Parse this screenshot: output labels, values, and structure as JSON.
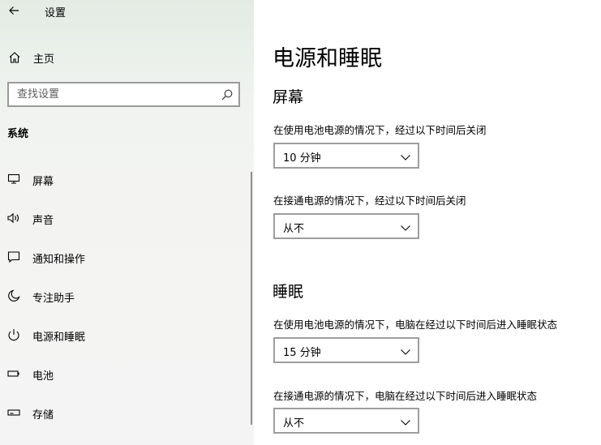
{
  "window": {
    "title": "设置"
  },
  "sidebar": {
    "home_label": "主页",
    "search": {
      "placeholder": "查找设置",
      "value": ""
    },
    "section": "系统",
    "items": [
      {
        "label": "屏幕",
        "icon": "monitor-icon"
      },
      {
        "label": "声音",
        "icon": "speaker-icon"
      },
      {
        "label": "通知和操作",
        "icon": "notification-icon"
      },
      {
        "label": "专注助手",
        "icon": "moon-icon"
      },
      {
        "label": "电源和睡眠",
        "icon": "power-icon"
      },
      {
        "label": "电池",
        "icon": "battery-icon"
      },
      {
        "label": "存储",
        "icon": "storage-icon"
      }
    ]
  },
  "main": {
    "title": "电源和睡眠",
    "screen": {
      "heading": "屏幕",
      "battery_desc": "在使用电池电源的情况下，经过以下时间后关闭",
      "battery_value": "10 分钟",
      "plugged_desc": "在接通电源的情况下，经过以下时间后关闭",
      "plugged_value": "从不"
    },
    "sleep": {
      "heading": "睡眠",
      "battery_desc": "在使用电池电源的情况下，电脑在经过以下时间后进入睡眠状态",
      "battery_value": "15 分钟",
      "plugged_desc": "在接通电源的情况下，电脑在经过以下时间后进入睡眠状态",
      "plugged_value": "从不"
    }
  },
  "colors": {
    "sidebar_bg": "#f3f4f2",
    "border": "#9d9d9d",
    "text": "#000000"
  }
}
